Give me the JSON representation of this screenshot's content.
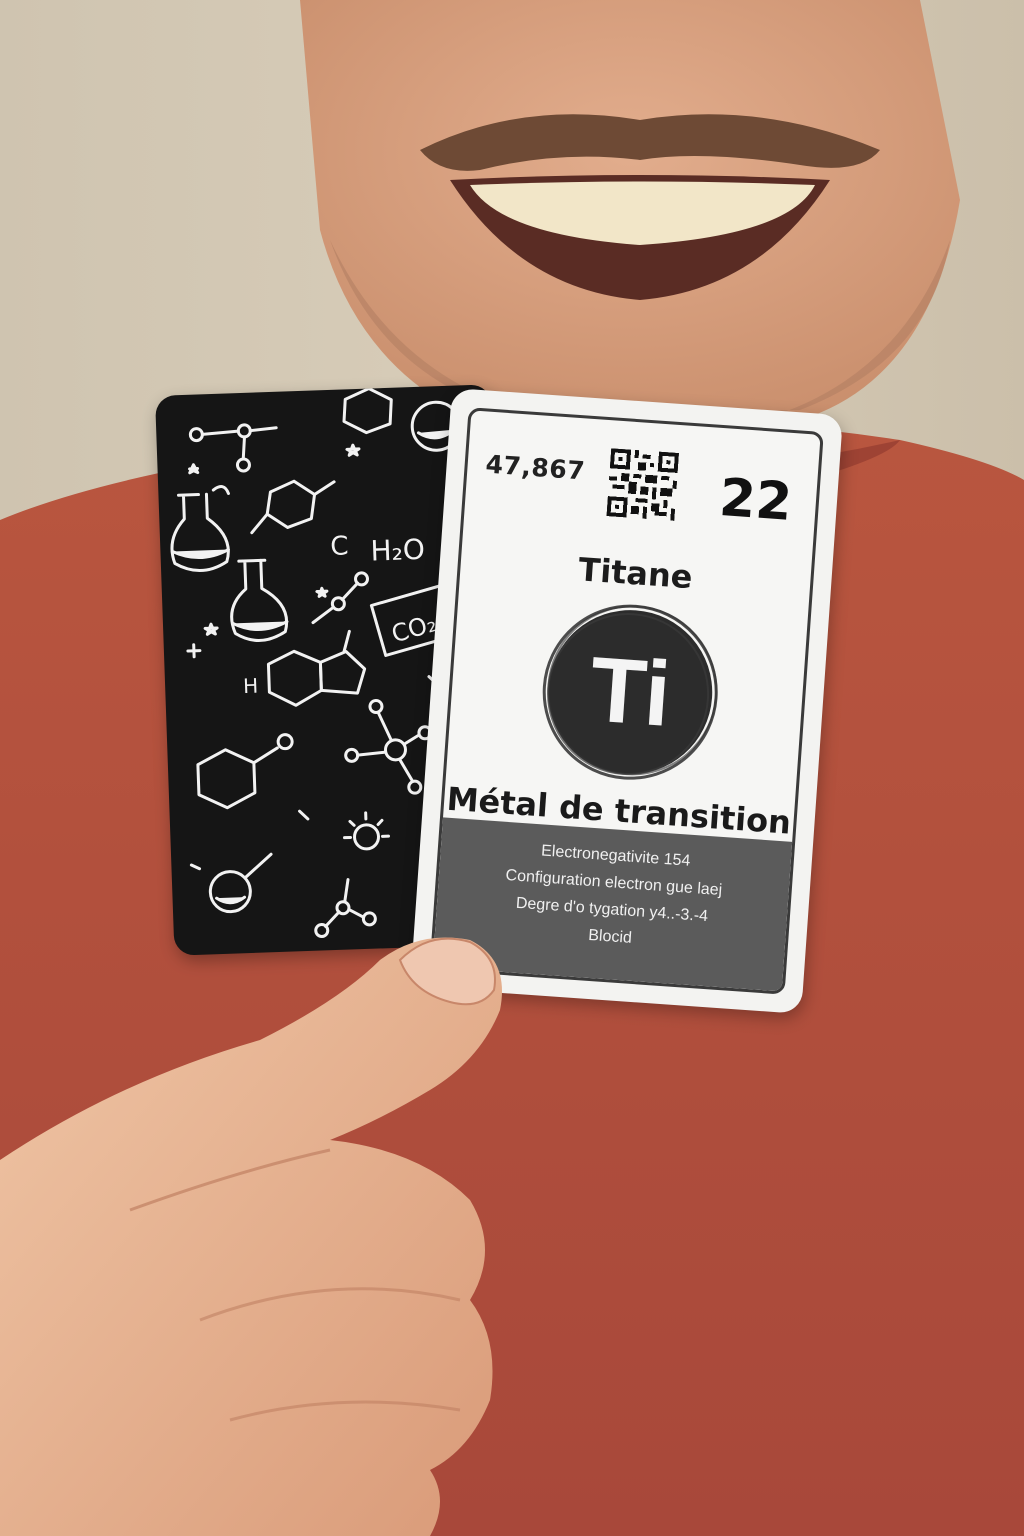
{
  "element_card": {
    "atomic_mass": "47,867",
    "atomic_number": "22",
    "name": "Titane",
    "symbol": "Ti",
    "category": "Métal de transition",
    "properties": [
      "Electronegativite 154",
      "Configuration electron gue laej",
      "Degre d'o tygation y4..-3.-4",
      "Blocid"
    ]
  },
  "back_card": {
    "doodles": [
      "H₂O",
      "CO₂",
      "C"
    ]
  },
  "colors": {
    "shirt": "#b5523f",
    "card_dark": "#151515",
    "card_light": "#f3f3f1",
    "props_band": "#5b5b5b"
  }
}
